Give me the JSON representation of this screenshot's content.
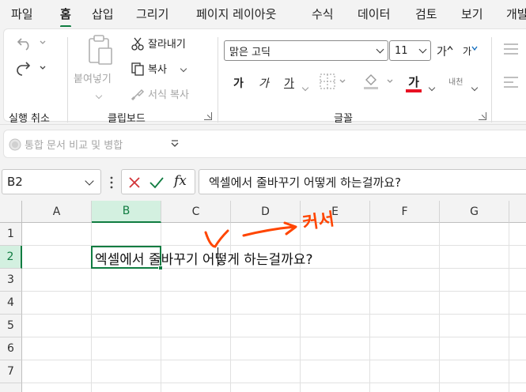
{
  "menu": {
    "tabs": [
      "파일",
      "홈",
      "삽입",
      "그리기",
      "페이지 레이아웃",
      "수식",
      "데이터",
      "검토",
      "보기",
      "개발"
    ]
  },
  "ribbon": {
    "undo_group": {
      "label": "실행 취소"
    },
    "clipboard": {
      "paste_label": "붙여넣기",
      "cut_label": "잘라내기",
      "copy_label": "복사",
      "format_painter_label": "서식 복사",
      "group_label": "클립보드"
    },
    "font": {
      "font_name": "맑은 고딕",
      "font_size": "11",
      "increase_size_glyph": "가",
      "decrease_size_glyph": "가",
      "bold_glyph": "가",
      "italic_glyph": "가",
      "underline_glyph": "가",
      "font_color_glyph": "가",
      "phonetic_label": "내천",
      "group_label": "글꼴",
      "font_color": "#e81123",
      "highlight_color": "#ffff00"
    }
  },
  "compare_bar": {
    "label": "통합 문서 비교 및 병합"
  },
  "formula_bar": {
    "name_box": "B2",
    "fx_label": "fx",
    "content": "엑셀에서 줄바꾸기 어떻게 하는걸까요?"
  },
  "grid": {
    "columns": [
      "A",
      "B",
      "C",
      "D",
      "E",
      "F",
      "G"
    ],
    "rows": [
      "1",
      "2",
      "3",
      "4",
      "5",
      "6",
      "7"
    ],
    "active_column": "B",
    "active_row": "2",
    "cell_B2": "엑셀에서 줄바꾸기 어떻게 하는걸까요?"
  },
  "annotation": {
    "text": "커서",
    "color": "#ff4500"
  },
  "colors": {
    "accent": "#107c41",
    "cancel": "#d13438",
    "enter": "#107c41"
  }
}
